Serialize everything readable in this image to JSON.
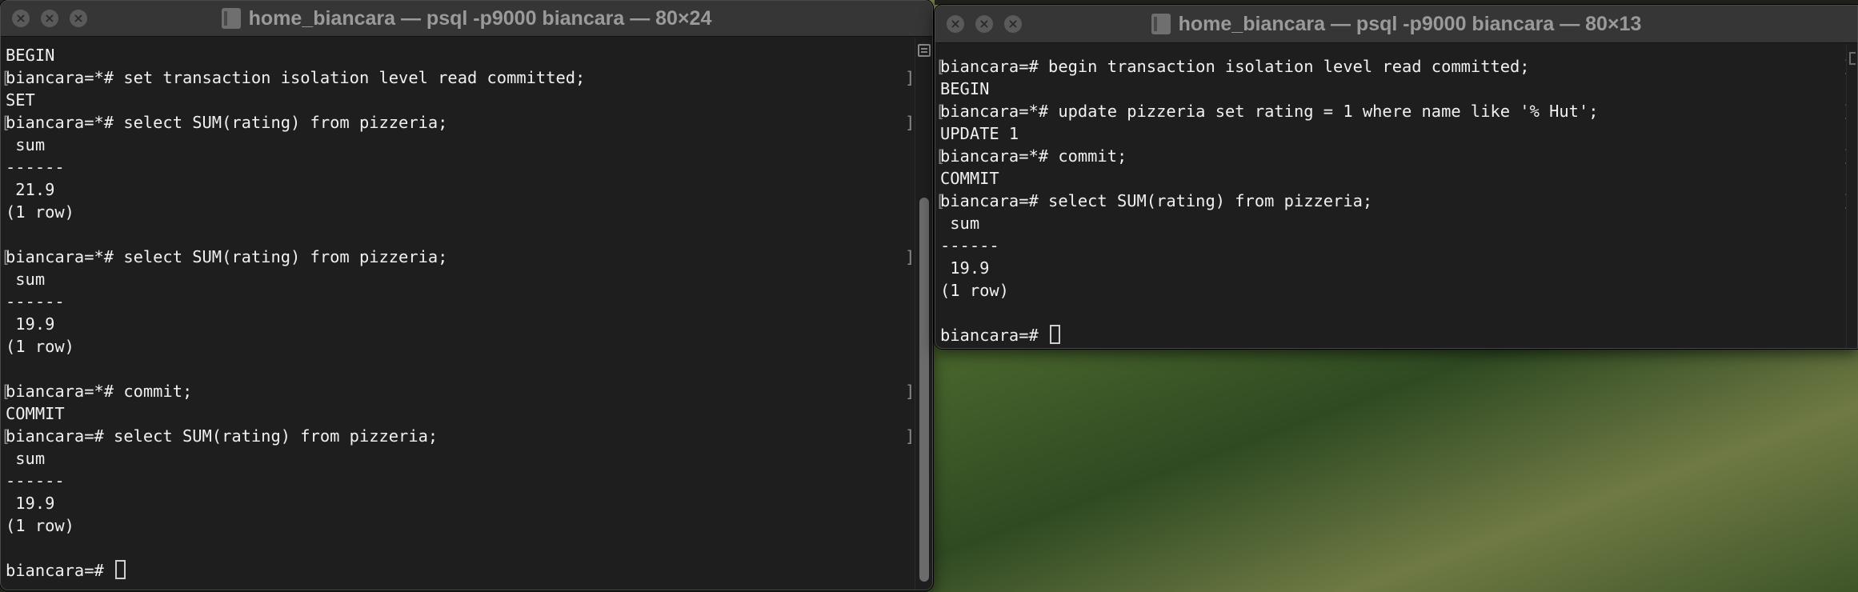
{
  "left_window": {
    "title": "home_biancara — psql -p9000 biancara — 80×24",
    "lines": [
      {
        "text": "BEGIN",
        "prompt": false
      },
      {
        "text": "biancara=*# set transaction isolation level read committed;",
        "prompt": true
      },
      {
        "text": "SET",
        "prompt": false
      },
      {
        "text": "biancara=*# select SUM(rating) from pizzeria;",
        "prompt": true
      },
      {
        "text": " sum",
        "prompt": false
      },
      {
        "text": "------",
        "prompt": false
      },
      {
        "text": " 21.9",
        "prompt": false
      },
      {
        "text": "(1 row)",
        "prompt": false
      },
      {
        "text": "",
        "prompt": false
      },
      {
        "text": "biancara=*# select SUM(rating) from pizzeria;",
        "prompt": true
      },
      {
        "text": " sum",
        "prompt": false
      },
      {
        "text": "------",
        "prompt": false
      },
      {
        "text": " 19.9",
        "prompt": false
      },
      {
        "text": "(1 row)",
        "prompt": false
      },
      {
        "text": "",
        "prompt": false
      },
      {
        "text": "biancara=*# commit;",
        "prompt": true
      },
      {
        "text": "COMMIT",
        "prompt": false
      },
      {
        "text": "biancara=# select SUM(rating) from pizzeria;",
        "prompt": true
      },
      {
        "text": " sum",
        "prompt": false
      },
      {
        "text": "------",
        "prompt": false
      },
      {
        "text": " 19.9",
        "prompt": false
      },
      {
        "text": "(1 row)",
        "prompt": false
      },
      {
        "text": "",
        "prompt": false
      }
    ],
    "current_prompt": "biancara=# "
  },
  "right_window": {
    "title": "home_biancara — psql -p9000 biancara — 80×13",
    "lines": [
      {
        "text": "biancara=# begin transaction isolation level read committed;",
        "prompt": true
      },
      {
        "text": "BEGIN",
        "prompt": false
      },
      {
        "text": "biancara=*# update pizzeria set rating = 1 where name like '% Hut';",
        "prompt": true
      },
      {
        "text": "UPDATE 1",
        "prompt": false
      },
      {
        "text": "biancara=*# commit;",
        "prompt": true
      },
      {
        "text": "COMMIT",
        "prompt": false
      },
      {
        "text": "biancara=# select SUM(rating) from pizzeria;",
        "prompt": true
      },
      {
        "text": " sum",
        "prompt": false
      },
      {
        "text": "------",
        "prompt": false
      },
      {
        "text": " 19.9",
        "prompt": false
      },
      {
        "text": "(1 row)",
        "prompt": false
      },
      {
        "text": "",
        "prompt": false
      }
    ],
    "current_prompt": "biancara=# "
  },
  "icons": {
    "close": "close-icon",
    "minimize": "minimize-icon",
    "zoom": "zoom-icon",
    "folder": "folder-icon",
    "scroll_marks": "scroll-marks-icon"
  },
  "colors": {
    "terminal_bg": "#1e1e1e",
    "terminal_text": "#f0f0f0",
    "titlebar_bg": "#363636"
  }
}
